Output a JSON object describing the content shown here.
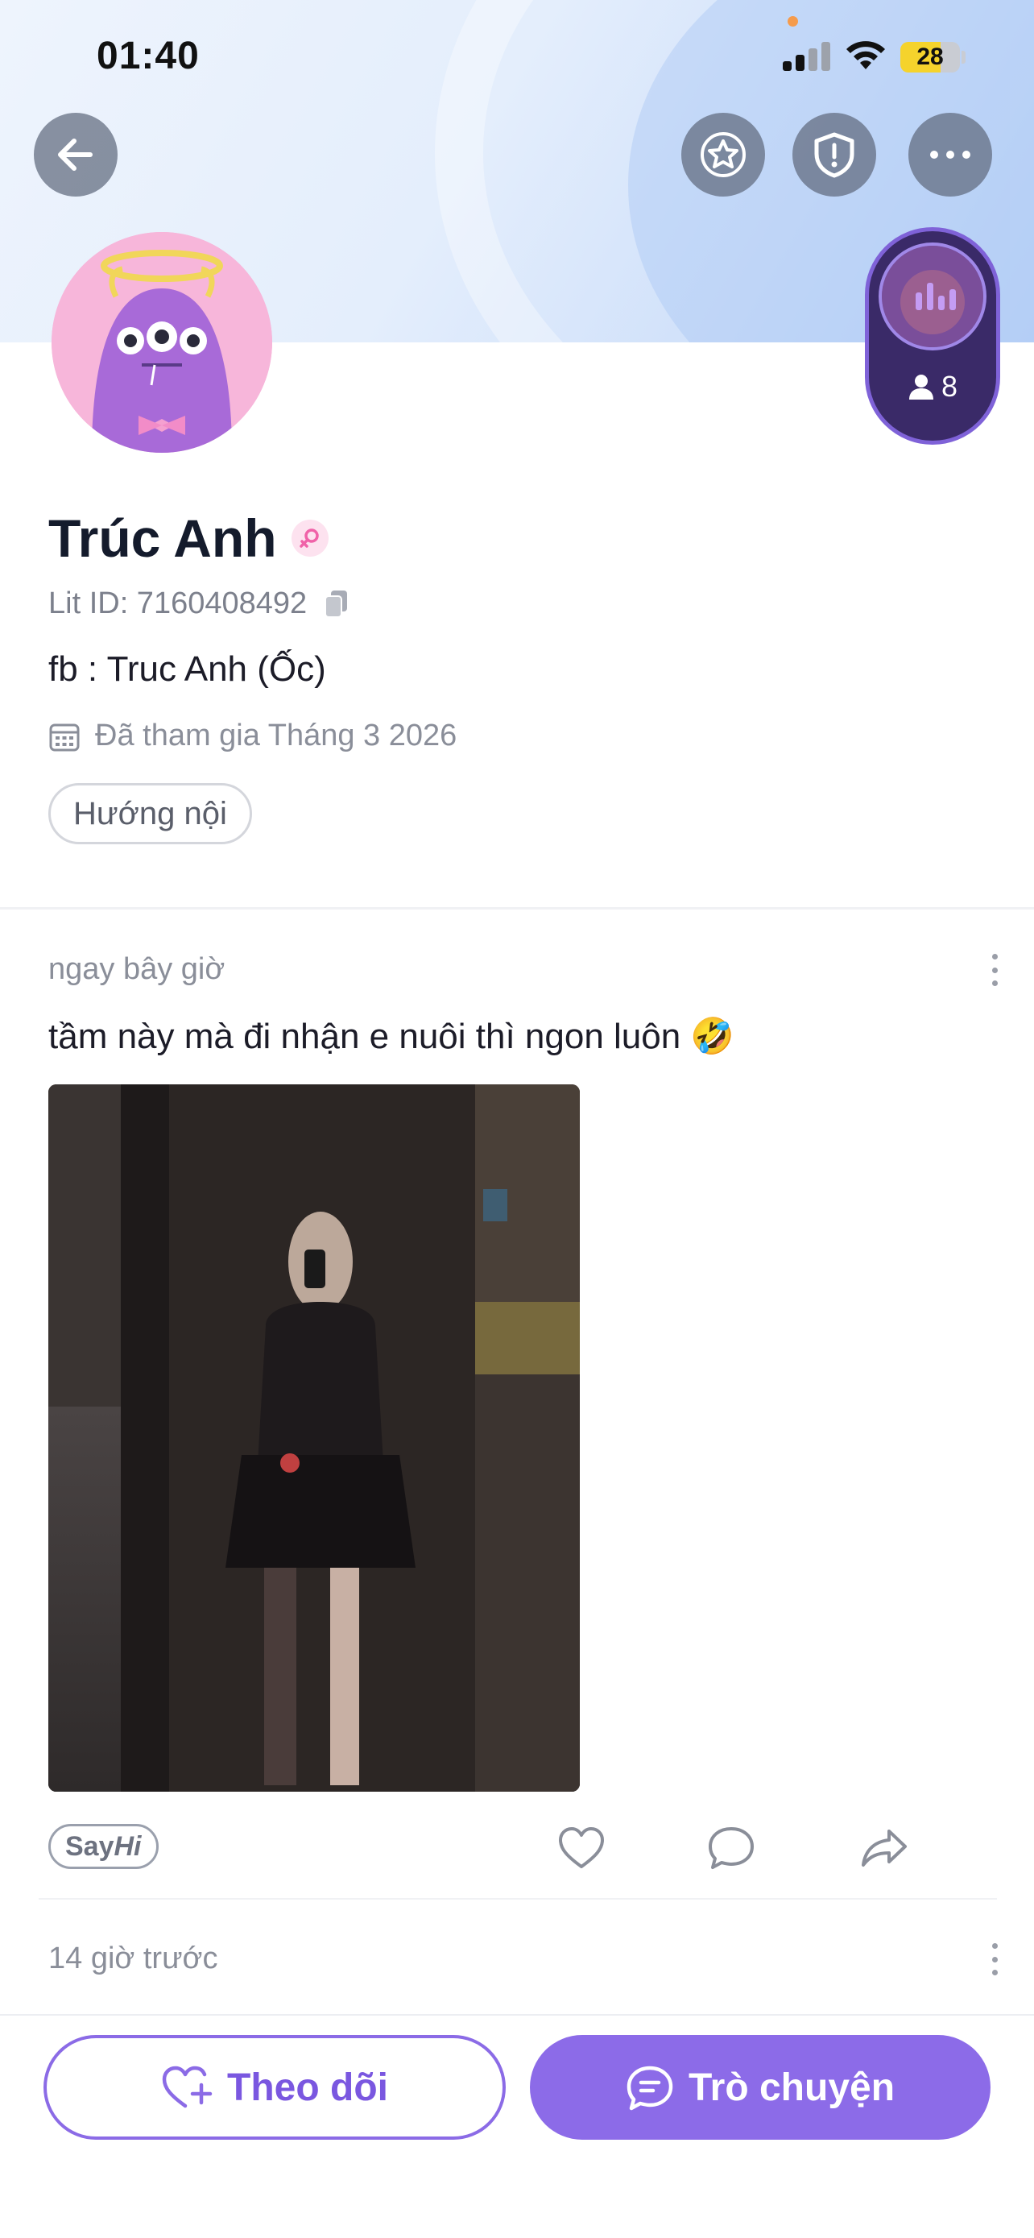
{
  "status_bar": {
    "time": "01:40",
    "battery": "28"
  },
  "header": {
    "back_icon": "arrow-left-icon",
    "star_icon": "star-icon",
    "shield_icon": "shield-alert-icon",
    "more_icon": "more-horizontal-icon"
  },
  "room_badge": {
    "count": "8"
  },
  "profile": {
    "name": "Trúc Anh",
    "lit_id": "Lit ID: 7160408492",
    "bio": "fb : Truc Anh (Ốc)",
    "joined": "Đã tham gia Tháng 3 2026",
    "tags": [
      "Hướng nội"
    ]
  },
  "posts": [
    {
      "time": "ngay bây giờ",
      "text": "tầm này mà đi nhận e nuôi thì ngon luôn 🤣"
    },
    {
      "time": "14 giờ trước"
    }
  ],
  "post_actions": {
    "sayhi_say": "Say",
    "sayhi_hi": "Hi"
  },
  "bottom_bar": {
    "follow_label": "Theo dõi",
    "chat_label": "Trò chuyện"
  },
  "colors": {
    "accent": "#8c6be8",
    "name": "#141b2c",
    "muted": "#8a8e99"
  }
}
